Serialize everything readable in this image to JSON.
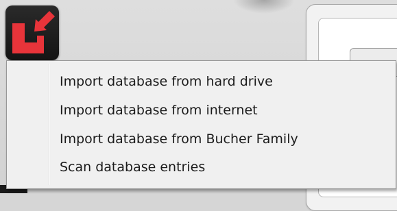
{
  "toolbar": {
    "import_icon": "import-arrow-icon",
    "import_icon_color": "#e8343a"
  },
  "menu": {
    "items": [
      {
        "label": "Import database from hard drive"
      },
      {
        "label": "Import database from internet"
      },
      {
        "label": "Import database from Bucher Family"
      },
      {
        "label": "Scan database entries"
      }
    ]
  },
  "colors": {
    "menu_background": "#f0f0f0",
    "menu_border": "#979797",
    "text": "#1b1b1b",
    "icon_background": "#1a1a1a"
  }
}
